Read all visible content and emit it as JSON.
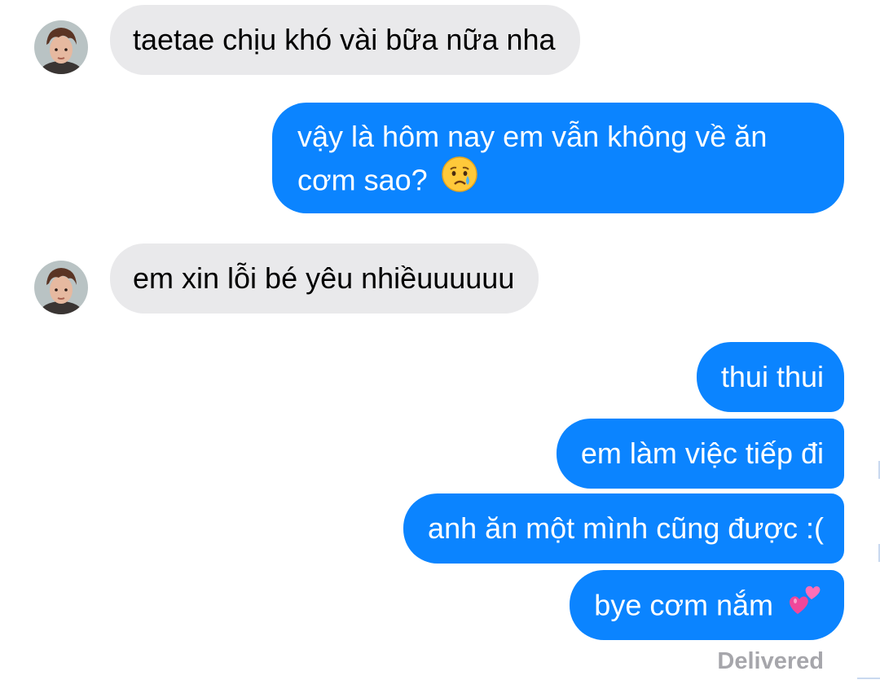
{
  "conversation": {
    "messages": [
      {
        "sender": "them",
        "text": "taetae chịu khó vài bữa nữa nha"
      },
      {
        "sender": "me",
        "text": "vậy là hôm nay em vẫn không về ăn cơm sao?",
        "emoji": "crying-face"
      },
      {
        "sender": "them",
        "text": "em xin lỗi bé yêu nhiềuuuuuu"
      },
      {
        "sender": "me",
        "text": "thui thui"
      },
      {
        "sender": "me",
        "text": "em làm việc tiếp đi"
      },
      {
        "sender": "me",
        "text": "anh ăn một mình cũng được :("
      },
      {
        "sender": "me",
        "text": "bye cơm nắm",
        "emoji": "two-hearts"
      }
    ],
    "status": "Delivered"
  },
  "colors": {
    "outgoing_bubble": "#0b84ff",
    "incoming_bubble": "#e9e9eb",
    "status_text": "#a6a6ab"
  }
}
